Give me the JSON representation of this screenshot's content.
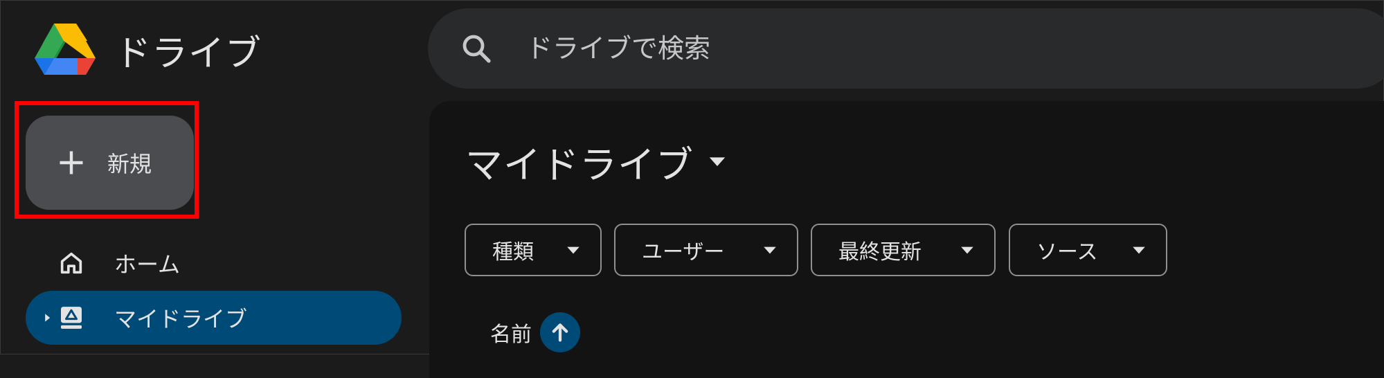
{
  "app": {
    "name": "ドライブ"
  },
  "search": {
    "placeholder": "ドライブで検索"
  },
  "new_button": {
    "label": "新規"
  },
  "nav": {
    "items": [
      {
        "label": "ホーム",
        "icon": "home-icon"
      },
      {
        "label": "マイドライブ",
        "icon": "my-drive-icon",
        "selected": true
      }
    ]
  },
  "main": {
    "title": "マイドライブ",
    "filters": [
      {
        "label": "種類"
      },
      {
        "label": "ユーザー"
      },
      {
        "label": "最終更新"
      },
      {
        "label": "ソース"
      }
    ],
    "columns": {
      "name": "名前",
      "sort": "ascending"
    }
  },
  "colors": {
    "background": "#1b1b1b",
    "main_panel": "#131313",
    "search_bg": "#282a2c",
    "new_button_bg": "#4a4c50",
    "selected_nav": "#004a77",
    "highlight": "#ff0000"
  }
}
